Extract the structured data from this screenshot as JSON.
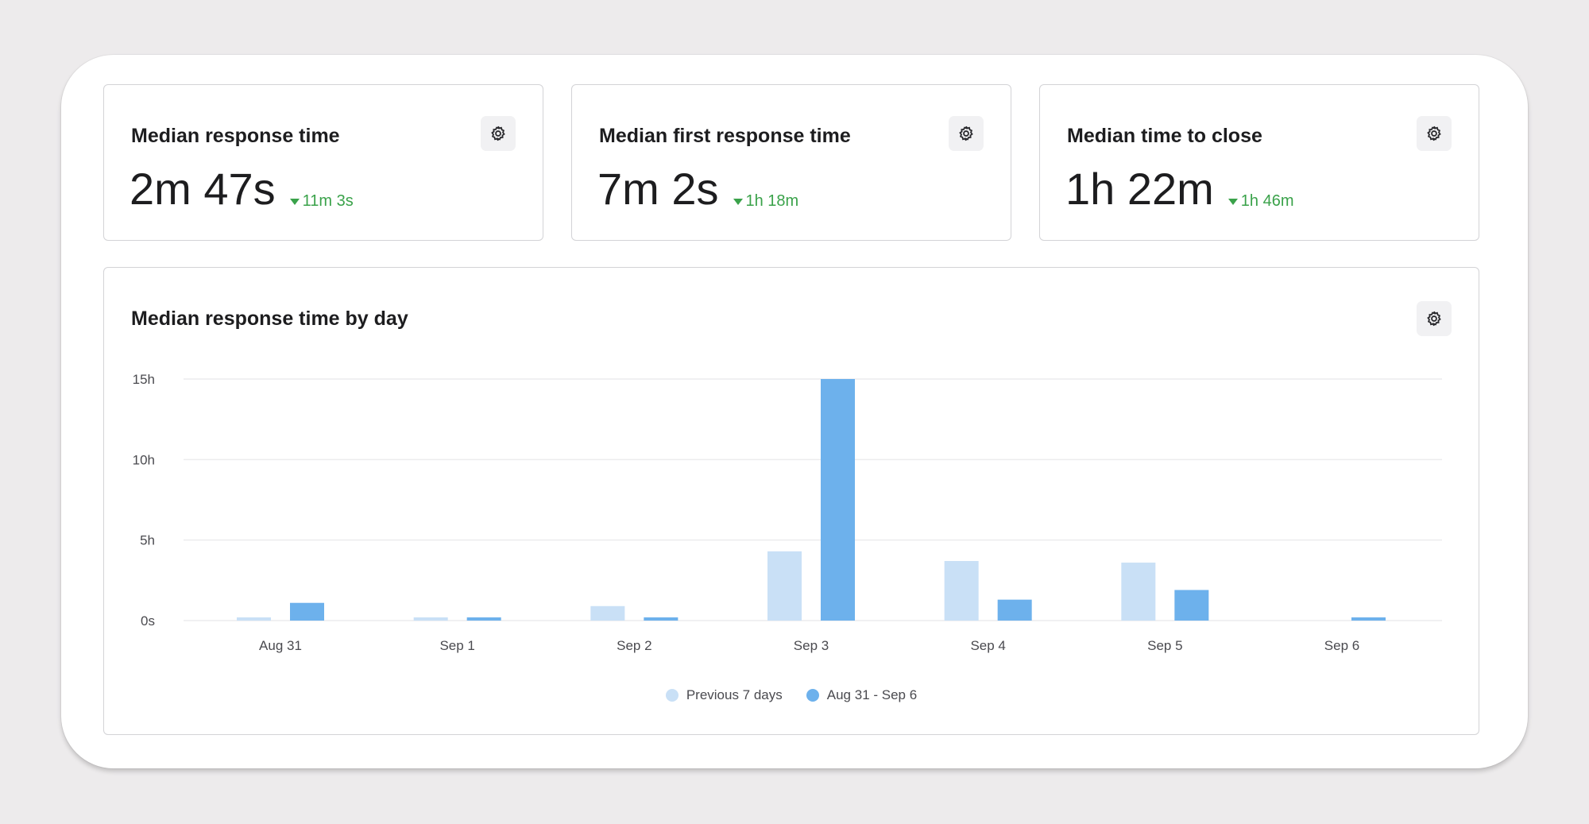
{
  "metrics": [
    {
      "title": "Median response time",
      "value": "2m 47s",
      "delta": "11m 3s",
      "delta_direction": "down"
    },
    {
      "title": "Median first response time",
      "value": "7m 2s",
      "delta": "1h 18m",
      "delta_direction": "down"
    },
    {
      "title": "Median time to close",
      "value": "1h 22m",
      "delta": "1h 46m",
      "delta_direction": "down"
    }
  ],
  "icons": {
    "settings": "gear-icon",
    "delta": "triangle-down-icon"
  },
  "colors": {
    "background": "#edebec",
    "positive_delta": "#3aa24a",
    "previous_series": "#c9e0f6",
    "current_series": "#6db1ec",
    "gridline": "#ececee"
  },
  "chart_section": {
    "title": "Median response time by day"
  },
  "chart_data": {
    "type": "bar",
    "title": "Median response time by day",
    "categories": [
      "Aug 31",
      "Sep 1",
      "Sep 2",
      "Sep 3",
      "Sep 4",
      "Sep 5",
      "Sep 6"
    ],
    "y_unit": "hours",
    "ylim": [
      0,
      15
    ],
    "yticks": [
      {
        "value": 0,
        "label": "0s"
      },
      {
        "value": 5,
        "label": "5h"
      },
      {
        "value": 10,
        "label": "10h"
      },
      {
        "value": 15,
        "label": "15h"
      }
    ],
    "series": [
      {
        "name": "Previous 7 days",
        "values": [
          0.2,
          0.2,
          0.9,
          4.3,
          3.7,
          3.6,
          0
        ]
      },
      {
        "name": "Aug 31 - Sep 6",
        "values": [
          1.1,
          0.2,
          0.2,
          15,
          1.3,
          1.9,
          0.2
        ]
      }
    ],
    "grid": true,
    "legend_position": "bottom-center"
  }
}
